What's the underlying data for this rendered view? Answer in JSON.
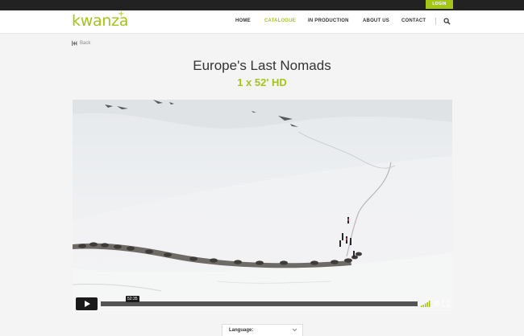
{
  "header": {
    "login_label": "LOGIN",
    "logo_text": "kwanza",
    "logo_plus": "+",
    "nav": [
      {
        "label": "HOME",
        "active": false
      },
      {
        "label": "CATALOGUE",
        "active": true
      },
      {
        "label": "IN PRODUCTION",
        "active": false
      },
      {
        "label": "ABOUT US",
        "active": false
      },
      {
        "label": "CONTACT",
        "active": false
      }
    ],
    "search_icon": "search-icon"
  },
  "back": {
    "label": "Back",
    "icon": "skip-back-icon"
  },
  "program": {
    "title": "Europe's Last Nomads",
    "format": "1 x 52' HD"
  },
  "player": {
    "time": "52:35",
    "progress": 0.0,
    "icons": [
      "play-icon",
      "volume-icon",
      "settings-icon",
      "fullscreen-icon"
    ]
  },
  "language": {
    "label": "Language:",
    "icon": "chevron-down-icon"
  },
  "colors": {
    "accent": "#a5c418",
    "topbar": "#222222"
  }
}
